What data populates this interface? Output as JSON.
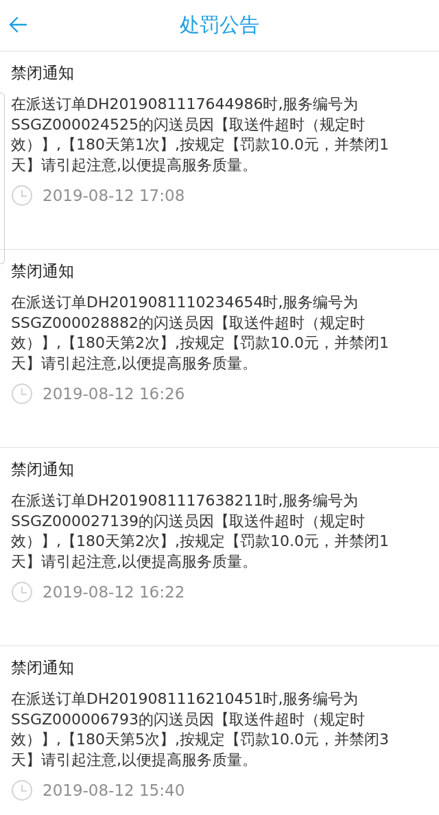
{
  "header": {
    "title": "处罚公告"
  },
  "notices": [
    {
      "title": "禁闭通知",
      "body": "在派送订单DH2019081117644986时,服务编号为SSGZ000024525的闪送员因【取送件超时（规定时效）】,【180天第1次】,按规定【罚款10.0元，并禁闭1天】请引起注意,以便提高服务质量。",
      "time": "2019-08-12 17:08"
    },
    {
      "title": "禁闭通知",
      "body": "在派送订单DH2019081110234654时,服务编号为SSGZ000028882的闪送员因【取送件超时（规定时效）】,【180天第2次】,按规定【罚款10.0元，并禁闭1天】请引起注意,以便提高服务质量。",
      "time": "2019-08-12 16:26"
    },
    {
      "title": "禁闭通知",
      "body": "在派送订单DH2019081117638211时,服务编号为SSGZ000027139的闪送员因【取送件超时（规定时效）】,【180天第2次】,按规定【罚款10.0元，并禁闭1天】请引起注意,以便提高服务质量。",
      "time": "2019-08-12 16:22"
    },
    {
      "title": "禁闭通知",
      "body": "在派送订单DH2019081116210451时,服务编号为SSGZ000006793的闪送员因【取送件超时（规定时效）】,【180天第5次】,按规定【罚款10.0元，并禁闭3天】请引起注意,以便提高服务质量。",
      "time": "2019-08-12 15:40"
    }
  ]
}
